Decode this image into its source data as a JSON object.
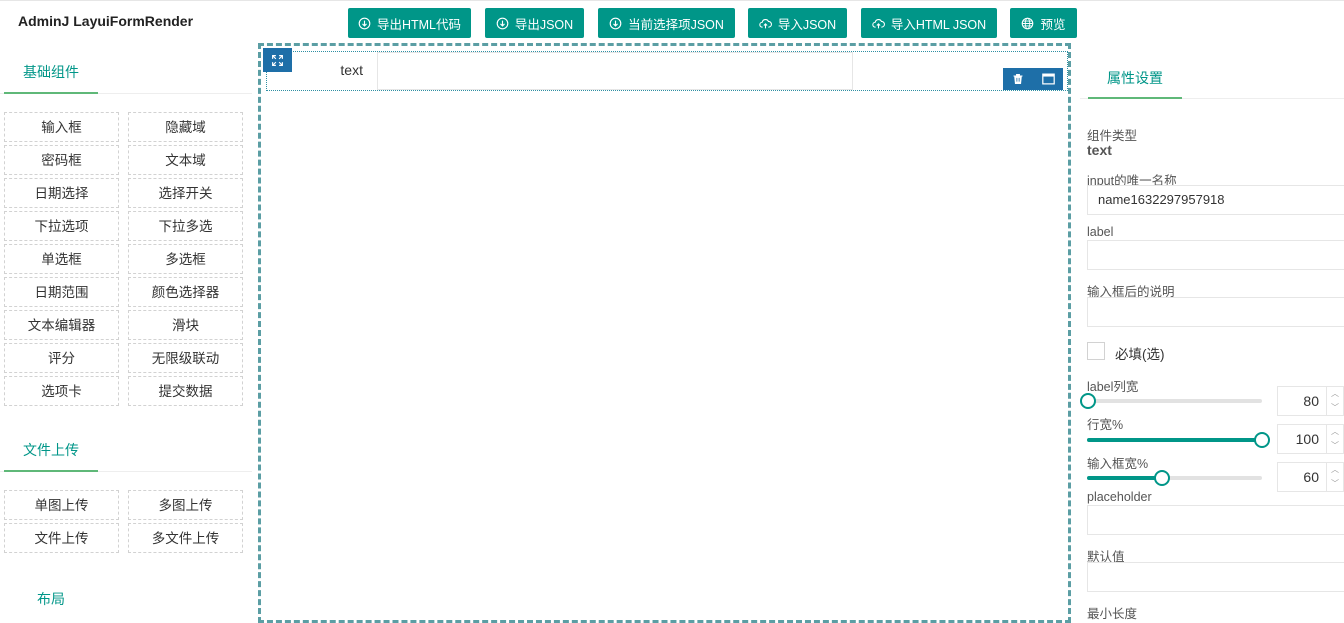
{
  "app": {
    "title": "AdminJ LayuiFormRender"
  },
  "toolbar": [
    {
      "label": "导出HTML代码",
      "icon": "download-icon"
    },
    {
      "label": "导出JSON",
      "icon": "download-icon"
    },
    {
      "label": "当前选择项JSON",
      "icon": "download-icon"
    },
    {
      "label": "导入JSON",
      "icon": "upload-cloud-icon"
    },
    {
      "label": "导入HTML JSON",
      "icon": "upload-cloud-icon"
    },
    {
      "label": "预览",
      "icon": "globe-icon"
    }
  ],
  "left": {
    "basic_title": "基础组件",
    "basic_items": [
      "输入框",
      "隐藏域",
      "密码框",
      "文本域",
      "日期选择",
      "选择开关",
      "下拉选项",
      "下拉多选",
      "单选框",
      "多选框",
      "日期范围",
      "颜色选择器",
      "文本编辑器",
      "滑块",
      "评分",
      "无限级联动",
      "选项卡",
      "提交数据"
    ],
    "upload_title": "文件上传",
    "upload_items": [
      "单图上传",
      "多图上传",
      "文件上传",
      "多文件上传"
    ],
    "layout_title": "布局"
  },
  "canvas": {
    "row_label": "text",
    "row_input_value": ""
  },
  "properties": {
    "tab": "属性设置",
    "type_label": "组件类型",
    "type_value": "text",
    "name_label": "input的唯一名称",
    "name_value": "name1632297957918",
    "label_label": "label",
    "label_value": "",
    "desc_label": "输入框后的说明",
    "desc_value": "",
    "required_label": "必填(选)",
    "label_width_label": "label列宽",
    "label_width_value": "80",
    "row_width_label": "行宽%",
    "row_width_value": "100",
    "input_width_label": "输入框宽%",
    "input_width_value": "60",
    "placeholder_label": "placeholder",
    "placeholder_value": "",
    "default_label": "默认值",
    "default_value": "",
    "minlen_label": "最小长度"
  },
  "colors": {
    "accent": "#009688",
    "selected": "#1e6fa8",
    "canvas_border": "#5b9ea4"
  }
}
